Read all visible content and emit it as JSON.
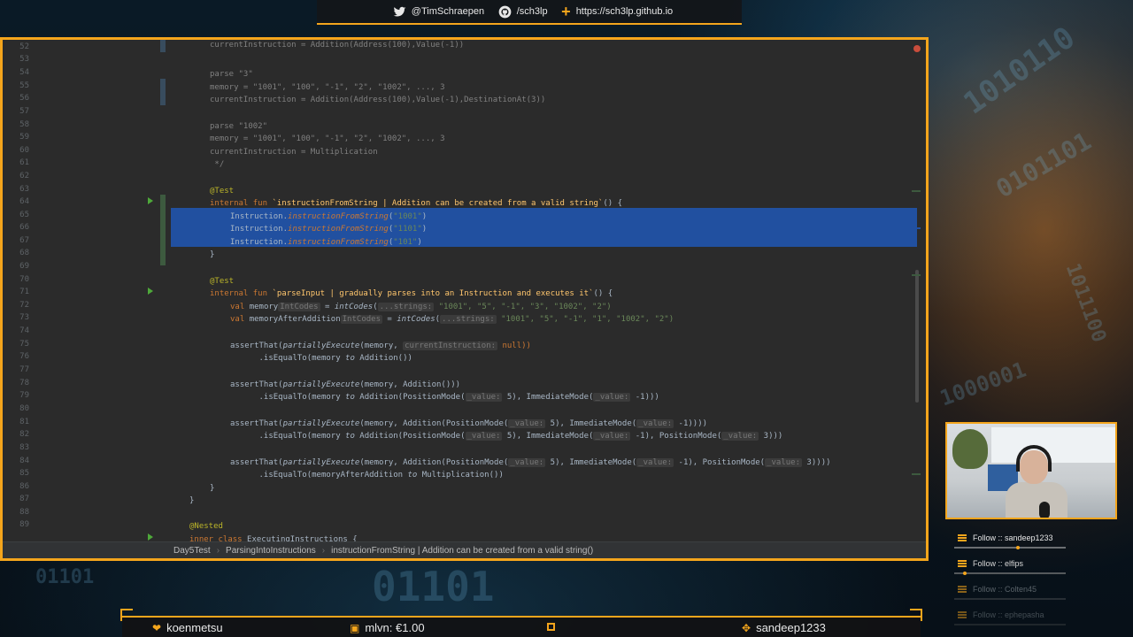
{
  "top_bar": {
    "twitter": "@TimSchraepen",
    "github": "/sch3lp",
    "website": "https://sch3lp.github.io"
  },
  "editor": {
    "line_numbers": [
      "52",
      "53",
      "54",
      "55",
      "56",
      "57",
      "58",
      "59",
      "60",
      "61",
      "62",
      "63",
      "64",
      "65",
      "66",
      "67",
      "68",
      "69",
      "70",
      "71",
      "72",
      "73",
      "74",
      "75",
      "76",
      "77",
      "78",
      "79",
      "80",
      "81",
      "82",
      "83",
      "84",
      "85",
      "86",
      "87",
      "88",
      "89"
    ],
    "code": {
      "l52": "currentInstruction = Addition(Address(100),Value(-1))",
      "l54": "parse \"3\"",
      "l55": "memory = \"1001\", \"100\", \"-1\", \"2\", \"1002\", ..., 3",
      "l56": "currentInstruction = Addition(Address(100),Value(-1),DestinationAt(3))",
      "l58": "parse \"1002\"",
      "l59": "memory = \"1001\", \"100\", \"-1\", \"2\", \"1002\", ..., 3",
      "l60": "currentInstruction = Multiplication",
      "l61": " */",
      "l63": "@Test",
      "l64_kw": "internal fun ",
      "l64_name": "`instructionFromString | Addition can be created from a valid string`",
      "l64_rest": "() {",
      "l65_a": "Instruction.",
      "l65_b": "instructionFromString",
      "l65_c": "(",
      "l65_s": "\"1001\"",
      "l65_d": ")",
      "l66_s": "\"1101\"",
      "l67_s": "\"101\"",
      "l68": "}",
      "l70": "@Test",
      "l71_kw": "internal fun ",
      "l71_name": "`parseInput | gradually parses into an Instruction and executes it`",
      "l71_rest": "() {",
      "l72_kw": "val ",
      "l72_var": "memory",
      "l72_hint": "IntCodes",
      "l72_eq": " = ",
      "l72_call": "intCodes",
      "l72_open": "(",
      "l72_hint2": "...strings:",
      "l72_args": " \"1001\", \"5\", \"-1\", \"3\", \"1002\", \"2\")",
      "l73_var": "memoryAfterAddition",
      "l73_args": " \"1001\", \"5\", \"-1\", \"1\", \"1002\", \"2\")",
      "l75_a": "assertThat(",
      "l75_call": "partiallyExecute",
      "l75_b": "(memory, ",
      "l75_hint": "currentInstruction:",
      "l75_c": " null))",
      "l76_a": "      .isEqualTo(memory ",
      "l76_to": "to",
      "l76_b": " Addition())",
      "l78_b": "(memory, Addition()))",
      "l79_b": " Addition(PositionMode(",
      "l79_hint": "_value:",
      "l79_c": " 5), ImmediateMode(",
      "l79_d": " -1)))",
      "l81_b": "(memory, Addition(PositionMode(",
      "l81_c": " 5), ImmediateMode(",
      "l81_d": " -1))))",
      "l82_c": " 5), ImmediateMode(",
      "l82_d": " -1), PositionMode(",
      "l82_e": " 3)))",
      "l84_b": "(memory, Addition(PositionMode(",
      "l84_c": " 5), ImmediateMode(",
      "l84_d": " -1), PositionMode(",
      "l84_e": " 3))))",
      "l85_a": "      .isEqualTo(memoryAfterAddition ",
      "l85_b": " Multiplication())",
      "l86": "}",
      "l87": "}",
      "l88": "@Nested",
      "l89_kw": "inner class ",
      "l89_name": "ExecutingInstructions {"
    },
    "breadcrumb": [
      "Day5Test",
      "ParsingIntoInstructions",
      "instructionFromString | Addition can be created from a valid string()"
    ]
  },
  "follows": [
    {
      "label": "Follow :: sandeep1233",
      "color": "#e6e6e6"
    },
    {
      "label": "Follow :: elfips",
      "color": "#d8d8d8"
    },
    {
      "label": "Follow :: Colten45",
      "color": "#7f8a90"
    },
    {
      "label": "Follow :: ephepasha",
      "color": "#6b7479"
    }
  ],
  "bottom_bar": {
    "follower": "koenmetsu",
    "donation": "mlvn: €1.00",
    "subscriber": "sandeep1233"
  },
  "colors": {
    "accent": "#f4a51c",
    "editor_bg": "#2b2b2b",
    "selection": "#2150a0"
  }
}
